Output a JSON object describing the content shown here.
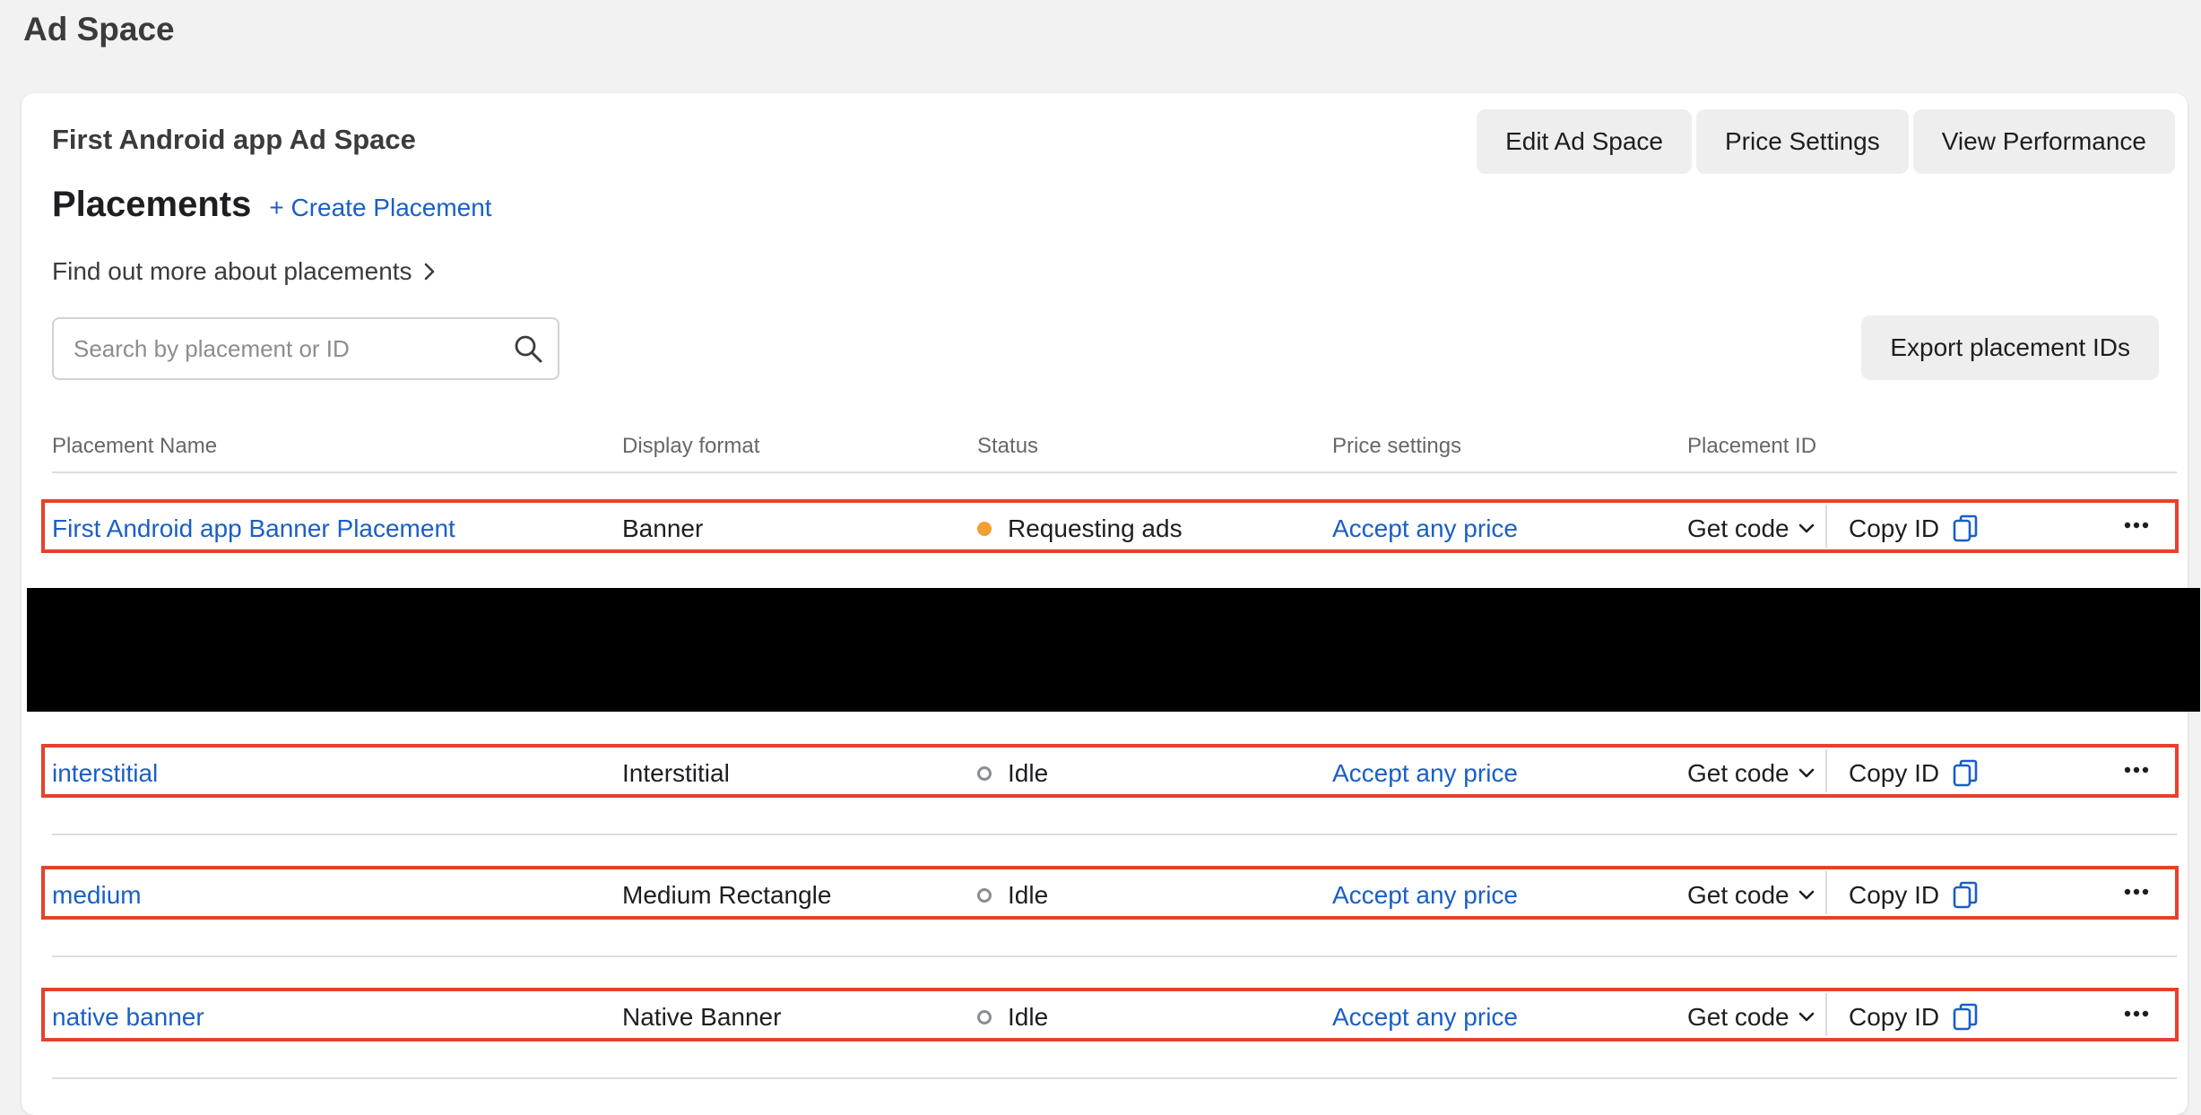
{
  "page": {
    "title": "Ad Space"
  },
  "adspace": {
    "name": "First Android app Ad Space"
  },
  "actions": {
    "edit": "Edit Ad Space",
    "price": "Price Settings",
    "performance": "View Performance"
  },
  "placements": {
    "title": "Placements",
    "create_label": "+ Create Placement",
    "learn_more": "Find out more about placements",
    "export_label": "Export placement IDs",
    "search_placeholder": "Search by placement or ID"
  },
  "table": {
    "headers": [
      "Placement Name",
      "Display format",
      "Status",
      "Price settings",
      "Placement ID"
    ],
    "get_code_label": "Get code",
    "copy_id_label": "Copy ID",
    "rows": [
      {
        "name": "First Android app Banner Placement",
        "format": "Banner",
        "status": "Requesting ads",
        "price": "Accept any price"
      },
      {
        "name": "interstitial",
        "format": "Interstitial",
        "status": "Idle",
        "price": "Accept any price"
      },
      {
        "name": "medium",
        "format": "Medium Rectangle",
        "status": "Idle",
        "price": "Accept any price"
      },
      {
        "name": "native banner",
        "format": "Native Banner",
        "status": "Idle",
        "price": "Accept any price"
      }
    ]
  },
  "colors": {
    "link": "#1a5fc6",
    "highlight_border": "#e5412d",
    "status_active": "#f0a030",
    "status_idle": "#8a8d91",
    "page_bg": "#f2f2f2"
  },
  "icons": [
    "search-icon",
    "chevron-right-icon",
    "chevron-down-icon",
    "copy-icon",
    "more-icon"
  ]
}
